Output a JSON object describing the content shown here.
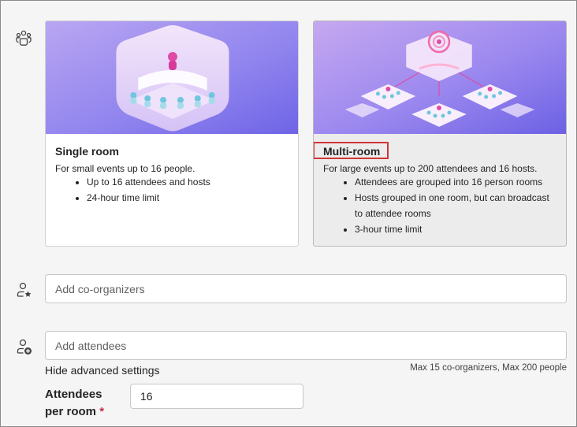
{
  "room_options": [
    {
      "title": "Single room",
      "description": "For small events up to 16 people.",
      "bullets": [
        "Up to 16 attendees and hosts",
        "24-hour time limit"
      ],
      "selected": false
    },
    {
      "title": "Multi-room",
      "description": "For large events up to 200 attendees and 16 hosts.",
      "bullets": [
        "Attendees are grouped into 16 person rooms",
        "Hosts grouped in one room, but can broadcast",
        "to attendee rooms",
        "3-hour time limit"
      ],
      "selected": true
    }
  ],
  "icons": {
    "room_type": "people-group-icon",
    "co_organizers": "person-star-icon",
    "attendees": "person-add-icon"
  },
  "co_organizers": {
    "placeholder": "Add co-organizers",
    "value": ""
  },
  "attendees": {
    "placeholder": "Add attendees",
    "value": ""
  },
  "advanced": {
    "hide_link": "Hide advanced settings",
    "limits_note": "Max 15 co-organizers, Max 200 people"
  },
  "attendees_per_room": {
    "label_line1": "Attendees",
    "label_line2": "per room",
    "required_mark": "*",
    "value": "16"
  },
  "colors": {
    "highlight_border": "#d13438",
    "required": "#c4314b",
    "art_purple": "#8a7cf0",
    "art_pink": "#e85fb0"
  }
}
